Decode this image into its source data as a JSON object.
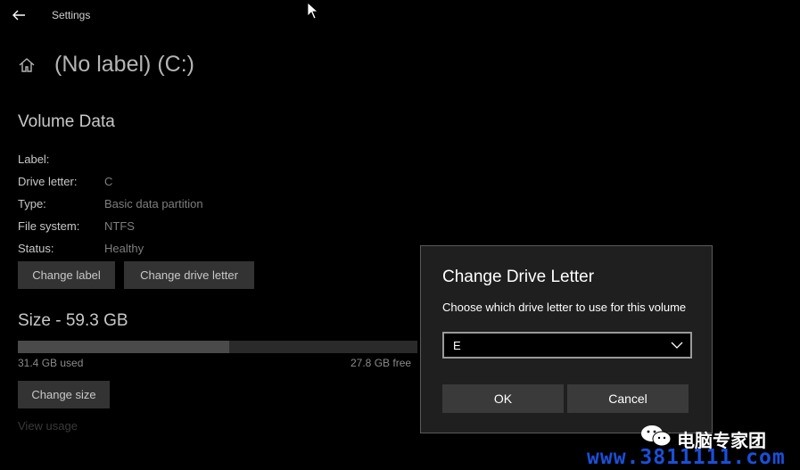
{
  "titlebar": {
    "title": "Settings"
  },
  "page": {
    "title": "(No label) (C:)"
  },
  "volume": {
    "heading": "Volume Data",
    "rows": [
      {
        "label": "Label:",
        "value": ""
      },
      {
        "label": "Drive letter:",
        "value": "C"
      },
      {
        "label": "Type:",
        "value": "Basic data partition"
      },
      {
        "label": "File system:",
        "value": "NTFS"
      },
      {
        "label": "Status:",
        "value": "Healthy"
      }
    ],
    "change_label_button": "Change label",
    "change_drive_letter_button": "Change drive letter"
  },
  "size": {
    "heading": "Size - 59.3 GB",
    "used_text": "31.4 GB used",
    "free_text": "27.8 GB free",
    "used_fraction": 0.53,
    "change_size_button": "Change size",
    "view_usage_link": "View usage"
  },
  "dialog": {
    "title": "Change Drive Letter",
    "description": "Choose which drive letter to use for this volume",
    "selected_letter": "E",
    "ok_button": "OK",
    "cancel_button": "Cancel"
  },
  "watermark": {
    "text": "电脑专家团",
    "url": "www.3811111.com",
    "icon": "wechat-icon"
  },
  "colors": {
    "background": "#000000",
    "dialog_bg": "#1f1f1f",
    "button_bg": "#333333",
    "watermark_url": "#1a4fd8"
  }
}
